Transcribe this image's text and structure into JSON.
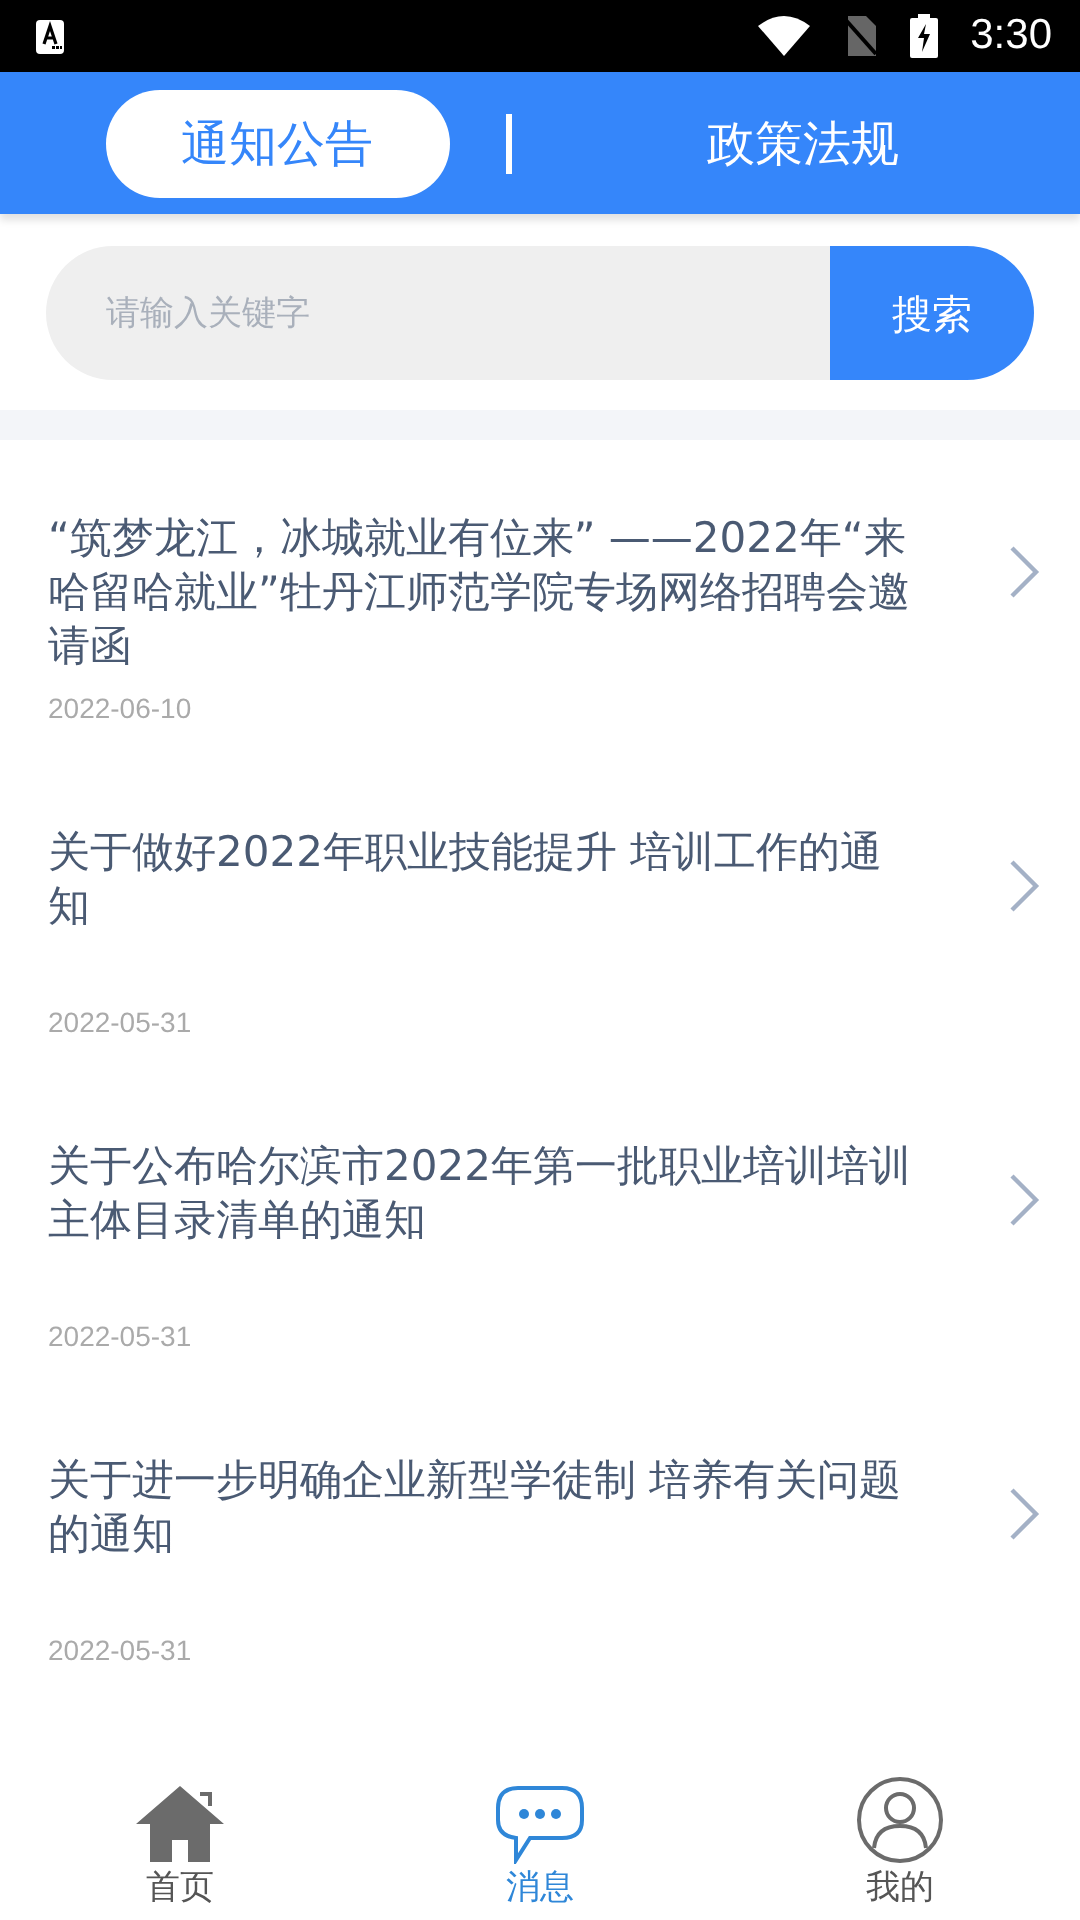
{
  "status_bar": {
    "time": "3:30"
  },
  "tabs": [
    {
      "label": "通知公告",
      "selected": true
    },
    {
      "label": "政策法规",
      "selected": false
    }
  ],
  "search": {
    "placeholder": "请输入关键字",
    "button": "搜索"
  },
  "notices": [
    {
      "title": "“筑梦龙江，冰城就业有位来” ——2022年“来哈留哈就业”牡丹江师范学院专场网络招聘会邀请函",
      "date": "2022-06-10"
    },
    {
      "title": "关于做好2022年职业技能提升 培训工作的通知",
      "date": "2022-05-31"
    },
    {
      "title": "关于公布哈尔滨市2022年第一批职业培训培训主体目录清单的通知",
      "date": "2022-05-31"
    },
    {
      "title": "关于进一步明确企业新型学徒制 培养有关问题的通知",
      "date": "2022-05-31"
    }
  ],
  "bottom_nav": [
    {
      "label": "首页",
      "kind": "home",
      "selected": false
    },
    {
      "label": "消息",
      "kind": "message",
      "selected": true
    },
    {
      "label": "我的",
      "kind": "profile",
      "selected": false
    }
  ]
}
